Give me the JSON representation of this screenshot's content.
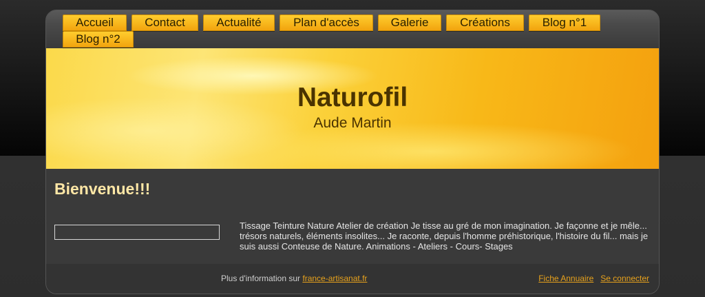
{
  "nav": {
    "items": [
      {
        "label": "Accueil"
      },
      {
        "label": "Contact"
      },
      {
        "label": "Actualité"
      },
      {
        "label": "Plan d'accès"
      },
      {
        "label": "Galerie"
      },
      {
        "label": "Créations"
      },
      {
        "label": "Blog n°1"
      },
      {
        "label": "Blog n°2"
      }
    ]
  },
  "banner": {
    "title": "Naturofil",
    "subtitle": "Aude Martin"
  },
  "main": {
    "heading": "Bienvenue!!!",
    "search_value": "",
    "description": "Tissage Teinture Nature Atelier de création  Je tisse au gré de mon imagination. Je façonne et je mêle... trésors naturels, éléments insolites... Je raconte, depuis l'homme préhistorique, l'histoire du fil... mais je suis aussi Conteuse de Nature. Animations - Ateliers - Cours- Stages"
  },
  "footer": {
    "info_prefix": "Plus d'information sur",
    "info_link": "france-artisanat.fr",
    "links": [
      {
        "label": "Fiche Annuaire"
      },
      {
        "label": "Se connecter"
      }
    ]
  },
  "colors": {
    "accent": "#f2a40e",
    "heading": "#ffe7a6",
    "link": "#e8a21c"
  }
}
